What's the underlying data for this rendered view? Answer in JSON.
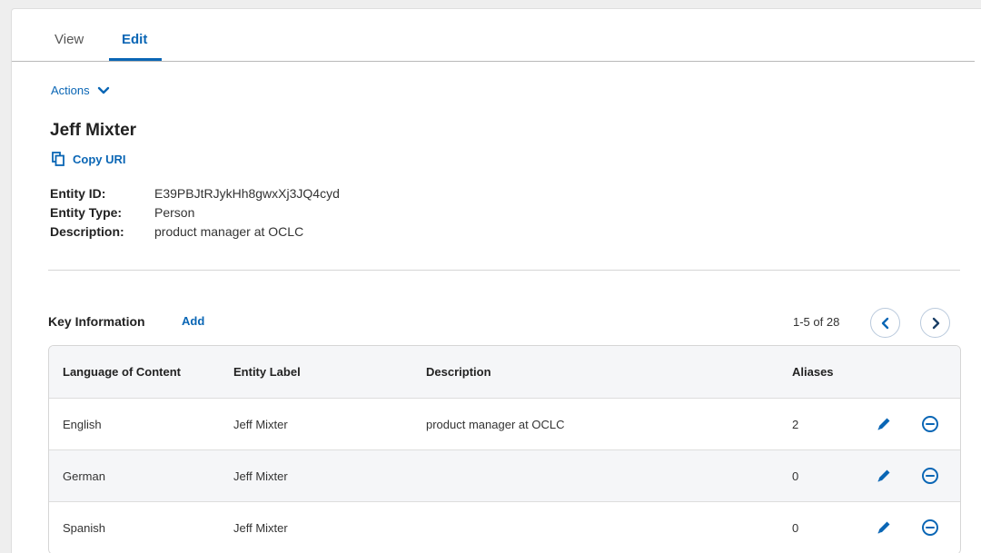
{
  "tabs": [
    {
      "label": "View",
      "active": false
    },
    {
      "label": "Edit",
      "active": true
    }
  ],
  "actions_label": "Actions",
  "entity": {
    "name": "Jeff Mixter",
    "copy_uri_label": "Copy URI",
    "fields": [
      {
        "label": "Entity ID:",
        "value": "E39PBJtRJykHh8gwxXj3JQ4cyd"
      },
      {
        "label": "Entity Type:",
        "value": "Person"
      },
      {
        "label": "Description:",
        "value": "product manager at OCLC"
      }
    ]
  },
  "key_info": {
    "title": "Key Information",
    "add_label": "Add",
    "pagination": "1-5 of 28",
    "columns": [
      "Language of Content",
      "Entity Label",
      "Description",
      "Aliases"
    ],
    "rows": [
      {
        "language": "English",
        "label": "Jeff Mixter",
        "description": "product manager at OCLC",
        "aliases": "2"
      },
      {
        "language": "German",
        "label": "Jeff Mixter",
        "description": "",
        "aliases": "0"
      },
      {
        "language": "Spanish",
        "label": "Jeff Mixter",
        "description": "",
        "aliases": "0"
      }
    ]
  },
  "colors": {
    "accent": "#0a66b5",
    "header_bg": "#f5f6f8"
  },
  "icons": {
    "edit": "pencil-icon",
    "remove": "minus-circle-icon",
    "copy": "copy-icon",
    "prev": "chevron-left-icon",
    "next": "chevron-right-icon",
    "actions": "chevron-down-icon"
  }
}
